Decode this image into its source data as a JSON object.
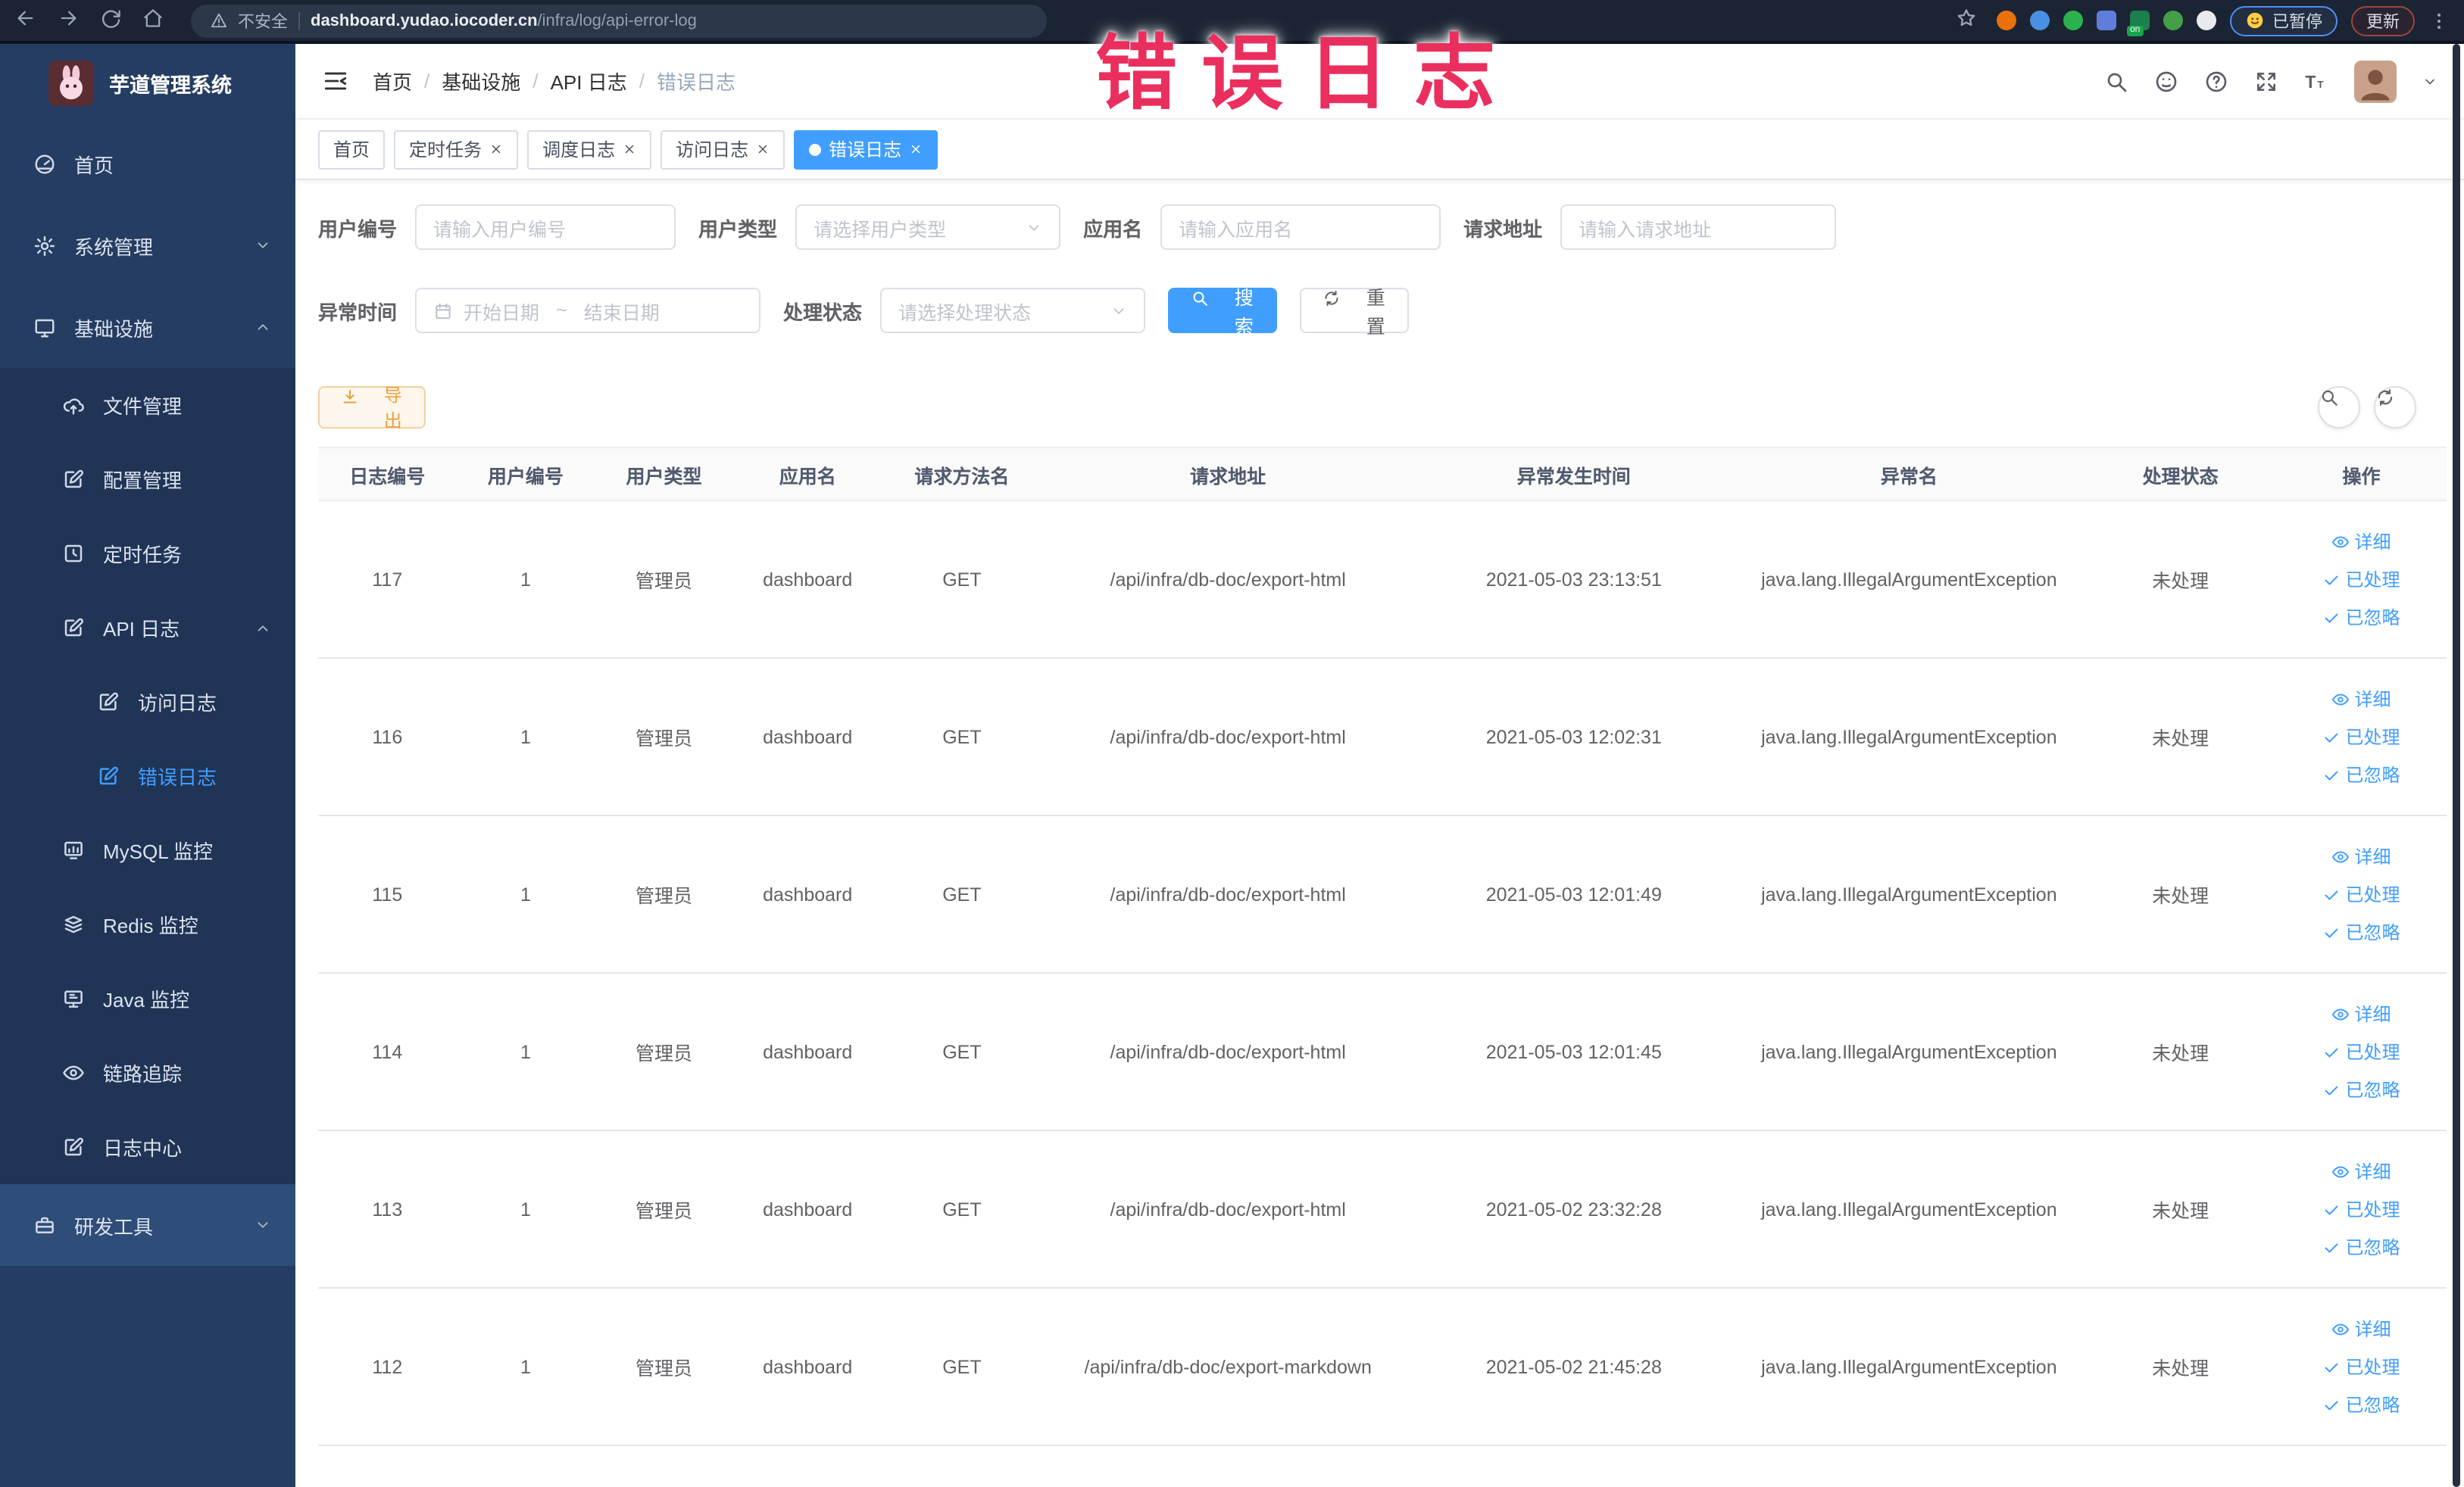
{
  "colors": {
    "accent": "#409eff",
    "annotation": "#ea2f5e",
    "sidebar_bg": "#253d62",
    "export_text": "#e6a23c"
  },
  "browser": {
    "security_label": "不安全",
    "url_domain": "dashboard.yudao.iocoder.cn",
    "url_path": "/infra/log/api-error-log",
    "paused_badge": "已暂停",
    "update_button": "更新",
    "extensions": [
      {
        "name": "ext-orange-circle",
        "color": "#e8710a",
        "shape": "circle"
      },
      {
        "name": "ext-blue-shield",
        "color": "#4a90e2",
        "shape": "circle"
      },
      {
        "name": "ext-green-check",
        "color": "#2bb24c",
        "shape": "circle"
      },
      {
        "name": "ext-blue-grid",
        "color": "#5f7ddb",
        "shape": "square"
      },
      {
        "name": "ext-green-on",
        "color": "#1d7f4f",
        "shape": "square",
        "badge": "on"
      },
      {
        "name": "ext-green-leaf",
        "color": "#43a047",
        "shape": "circle"
      },
      {
        "name": "ext-white-puzzle",
        "color": "#e8eaed",
        "shape": "circle"
      }
    ]
  },
  "annotation": {
    "text": "错误日志"
  },
  "sidebar": {
    "title": "芋道管理系统",
    "items": [
      {
        "id": "home",
        "label": "首页",
        "icon": "dashboard",
        "level": 0
      },
      {
        "id": "system",
        "label": "系统管理",
        "icon": "gear",
        "level": 0,
        "chevron": "down"
      },
      {
        "id": "infra",
        "label": "基础设施",
        "icon": "monitor",
        "level": 0,
        "chevron": "up"
      },
      {
        "id": "file",
        "label": "文件管理",
        "icon": "cloudup",
        "level": 1
      },
      {
        "id": "config",
        "label": "配置管理",
        "icon": "editsq",
        "level": 1
      },
      {
        "id": "job",
        "label": "定时任务",
        "icon": "job",
        "level": 1
      },
      {
        "id": "api-log",
        "label": "API 日志",
        "icon": "editsq",
        "level": 1,
        "chevron": "up"
      },
      {
        "id": "access-log",
        "label": "访问日志",
        "icon": "editsq",
        "level": 2
      },
      {
        "id": "error-log",
        "label": "错误日志",
        "icon": "editsq",
        "level": 2,
        "active": true
      },
      {
        "id": "mysql",
        "label": "MySQL 监控",
        "icon": "mysql",
        "level": 1
      },
      {
        "id": "redis",
        "label": "Redis 监控",
        "icon": "redis",
        "level": 1
      },
      {
        "id": "java",
        "label": "Java 监控",
        "icon": "javamon",
        "level": 1
      },
      {
        "id": "trace",
        "label": "链路追踪",
        "icon": "eye",
        "level": 1
      },
      {
        "id": "log-center",
        "label": "日志中心",
        "icon": "editsq",
        "level": 1
      },
      {
        "id": "devtools",
        "label": "研发工具",
        "icon": "briefcase",
        "level": 0,
        "chevron": "down",
        "hover": true
      }
    ]
  },
  "breadcrumb": [
    "首页",
    "基础设施",
    "API 日志",
    "错误日志"
  ],
  "tabs": [
    {
      "label": "首页",
      "closable": false,
      "active": false
    },
    {
      "label": "定时任务",
      "closable": true,
      "active": false
    },
    {
      "label": "调度日志",
      "closable": true,
      "active": false
    },
    {
      "label": "访问日志",
      "closable": true,
      "active": false
    },
    {
      "label": "错误日志",
      "closable": true,
      "active": true
    }
  ],
  "filters": {
    "user_id": {
      "label": "用户编号",
      "placeholder": "请输入用户编号"
    },
    "user_type": {
      "label": "用户类型",
      "placeholder": "请选择用户类型"
    },
    "app_name": {
      "label": "应用名",
      "placeholder": "请输入应用名"
    },
    "request_url": {
      "label": "请求地址",
      "placeholder": "请输入请求地址"
    },
    "exception_time": {
      "label": "异常时间",
      "start_placeholder": "开始日期",
      "separator": "~",
      "end_placeholder": "结束日期"
    },
    "process_status": {
      "label": "处理状态",
      "placeholder": "请选择处理状态"
    },
    "search_button": "搜索",
    "reset_button": "重置"
  },
  "toolbar": {
    "export_button": "导出"
  },
  "table": {
    "columns": [
      "日志编号",
      "用户编号",
      "用户类型",
      "应用名",
      "请求方法名",
      "请求地址",
      "异常发生时间",
      "异常名",
      "处理状态",
      "操作"
    ],
    "row_actions": [
      "详细",
      "已处理",
      "已忽略"
    ],
    "rows": [
      {
        "id": "117",
        "user_id": "1",
        "user_type": "管理员",
        "app_name": "dashboard",
        "method": "GET",
        "url": "/api/infra/db-doc/export-html",
        "time": "2021-05-03 23:13:51",
        "exception": "java.lang.IllegalArgumentException",
        "status": "未处理"
      },
      {
        "id": "116",
        "user_id": "1",
        "user_type": "管理员",
        "app_name": "dashboard",
        "method": "GET",
        "url": "/api/infra/db-doc/export-html",
        "time": "2021-05-03 12:02:31",
        "exception": "java.lang.IllegalArgumentException",
        "status": "未处理"
      },
      {
        "id": "115",
        "user_id": "1",
        "user_type": "管理员",
        "app_name": "dashboard",
        "method": "GET",
        "url": "/api/infra/db-doc/export-html",
        "time": "2021-05-03 12:01:49",
        "exception": "java.lang.IllegalArgumentException",
        "status": "未处理"
      },
      {
        "id": "114",
        "user_id": "1",
        "user_type": "管理员",
        "app_name": "dashboard",
        "method": "GET",
        "url": "/api/infra/db-doc/export-html",
        "time": "2021-05-03 12:01:45",
        "exception": "java.lang.IllegalArgumentException",
        "status": "未处理"
      },
      {
        "id": "113",
        "user_id": "1",
        "user_type": "管理员",
        "app_name": "dashboard",
        "method": "GET",
        "url": "/api/infra/db-doc/export-html",
        "time": "2021-05-02 23:32:28",
        "exception": "java.lang.IllegalArgumentException",
        "status": "未处理"
      },
      {
        "id": "112",
        "user_id": "1",
        "user_type": "管理员",
        "app_name": "dashboard",
        "method": "GET",
        "url": "/api/infra/db-doc/export-markdown",
        "time": "2021-05-02 21:45:28",
        "exception": "java.lang.IllegalArgumentException",
        "status": "未处理"
      }
    ]
  }
}
